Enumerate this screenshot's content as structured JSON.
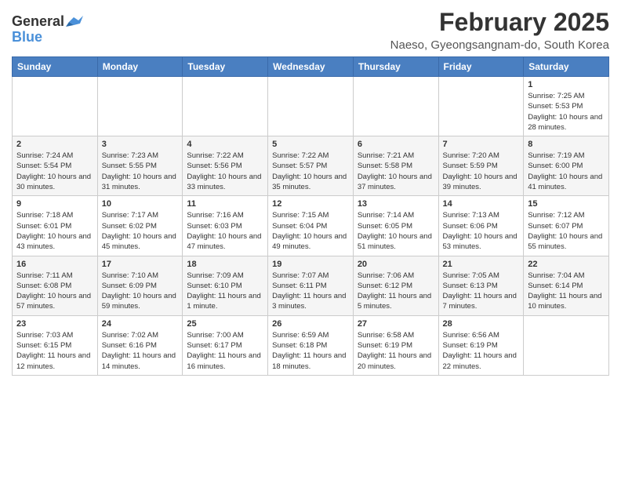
{
  "header": {
    "logo": {
      "line1": "General",
      "line2": "Blue"
    },
    "month": "February 2025",
    "location": "Naeso, Gyeongsangnam-do, South Korea"
  },
  "weekdays": [
    "Sunday",
    "Monday",
    "Tuesday",
    "Wednesday",
    "Thursday",
    "Friday",
    "Saturday"
  ],
  "weeks": [
    [
      {
        "day": "",
        "info": ""
      },
      {
        "day": "",
        "info": ""
      },
      {
        "day": "",
        "info": ""
      },
      {
        "day": "",
        "info": ""
      },
      {
        "day": "",
        "info": ""
      },
      {
        "day": "",
        "info": ""
      },
      {
        "day": "1",
        "info": "Sunrise: 7:25 AM\nSunset: 5:53 PM\nDaylight: 10 hours and 28 minutes."
      }
    ],
    [
      {
        "day": "2",
        "info": "Sunrise: 7:24 AM\nSunset: 5:54 PM\nDaylight: 10 hours and 30 minutes."
      },
      {
        "day": "3",
        "info": "Sunrise: 7:23 AM\nSunset: 5:55 PM\nDaylight: 10 hours and 31 minutes."
      },
      {
        "day": "4",
        "info": "Sunrise: 7:22 AM\nSunset: 5:56 PM\nDaylight: 10 hours and 33 minutes."
      },
      {
        "day": "5",
        "info": "Sunrise: 7:22 AM\nSunset: 5:57 PM\nDaylight: 10 hours and 35 minutes."
      },
      {
        "day": "6",
        "info": "Sunrise: 7:21 AM\nSunset: 5:58 PM\nDaylight: 10 hours and 37 minutes."
      },
      {
        "day": "7",
        "info": "Sunrise: 7:20 AM\nSunset: 5:59 PM\nDaylight: 10 hours and 39 minutes."
      },
      {
        "day": "8",
        "info": "Sunrise: 7:19 AM\nSunset: 6:00 PM\nDaylight: 10 hours and 41 minutes."
      }
    ],
    [
      {
        "day": "9",
        "info": "Sunrise: 7:18 AM\nSunset: 6:01 PM\nDaylight: 10 hours and 43 minutes."
      },
      {
        "day": "10",
        "info": "Sunrise: 7:17 AM\nSunset: 6:02 PM\nDaylight: 10 hours and 45 minutes."
      },
      {
        "day": "11",
        "info": "Sunrise: 7:16 AM\nSunset: 6:03 PM\nDaylight: 10 hours and 47 minutes."
      },
      {
        "day": "12",
        "info": "Sunrise: 7:15 AM\nSunset: 6:04 PM\nDaylight: 10 hours and 49 minutes."
      },
      {
        "day": "13",
        "info": "Sunrise: 7:14 AM\nSunset: 6:05 PM\nDaylight: 10 hours and 51 minutes."
      },
      {
        "day": "14",
        "info": "Sunrise: 7:13 AM\nSunset: 6:06 PM\nDaylight: 10 hours and 53 minutes."
      },
      {
        "day": "15",
        "info": "Sunrise: 7:12 AM\nSunset: 6:07 PM\nDaylight: 10 hours and 55 minutes."
      }
    ],
    [
      {
        "day": "16",
        "info": "Sunrise: 7:11 AM\nSunset: 6:08 PM\nDaylight: 10 hours and 57 minutes."
      },
      {
        "day": "17",
        "info": "Sunrise: 7:10 AM\nSunset: 6:09 PM\nDaylight: 10 hours and 59 minutes."
      },
      {
        "day": "18",
        "info": "Sunrise: 7:09 AM\nSunset: 6:10 PM\nDaylight: 11 hours and 1 minute."
      },
      {
        "day": "19",
        "info": "Sunrise: 7:07 AM\nSunset: 6:11 PM\nDaylight: 11 hours and 3 minutes."
      },
      {
        "day": "20",
        "info": "Sunrise: 7:06 AM\nSunset: 6:12 PM\nDaylight: 11 hours and 5 minutes."
      },
      {
        "day": "21",
        "info": "Sunrise: 7:05 AM\nSunset: 6:13 PM\nDaylight: 11 hours and 7 minutes."
      },
      {
        "day": "22",
        "info": "Sunrise: 7:04 AM\nSunset: 6:14 PM\nDaylight: 11 hours and 10 minutes."
      }
    ],
    [
      {
        "day": "23",
        "info": "Sunrise: 7:03 AM\nSunset: 6:15 PM\nDaylight: 11 hours and 12 minutes."
      },
      {
        "day": "24",
        "info": "Sunrise: 7:02 AM\nSunset: 6:16 PM\nDaylight: 11 hours and 14 minutes."
      },
      {
        "day": "25",
        "info": "Sunrise: 7:00 AM\nSunset: 6:17 PM\nDaylight: 11 hours and 16 minutes."
      },
      {
        "day": "26",
        "info": "Sunrise: 6:59 AM\nSunset: 6:18 PM\nDaylight: 11 hours and 18 minutes."
      },
      {
        "day": "27",
        "info": "Sunrise: 6:58 AM\nSunset: 6:19 PM\nDaylight: 11 hours and 20 minutes."
      },
      {
        "day": "28",
        "info": "Sunrise: 6:56 AM\nSunset: 6:19 PM\nDaylight: 11 hours and 22 minutes."
      },
      {
        "day": "",
        "info": ""
      }
    ]
  ]
}
